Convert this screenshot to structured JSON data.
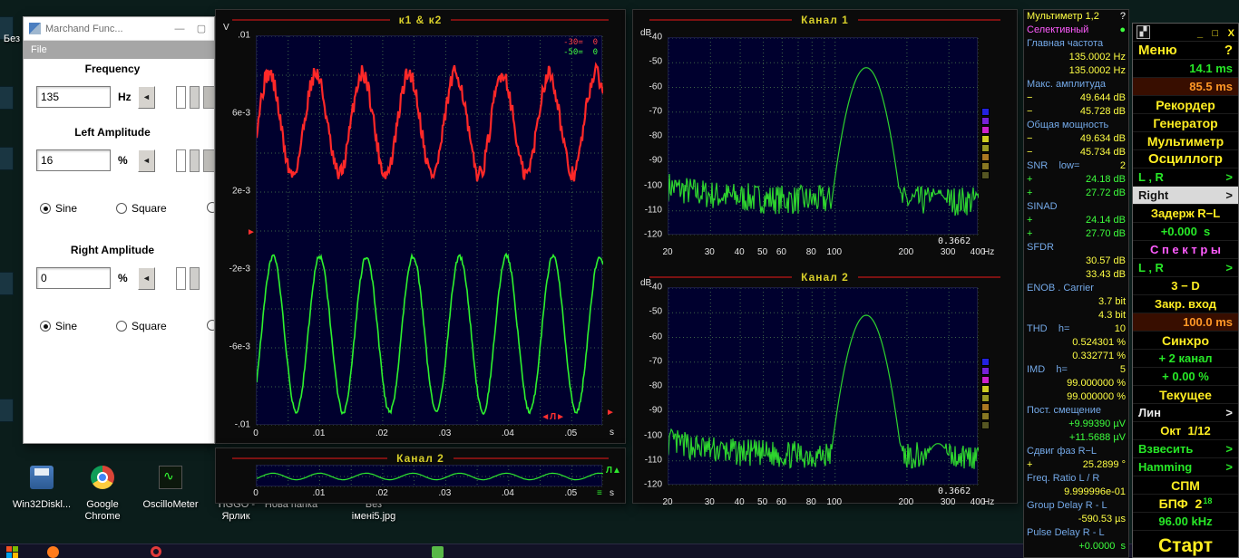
{
  "glyphs": {
    "arrow_right": "►",
    "spin_left": "◄",
    "pulse_trigger": "◄Л►",
    "pulse_up": "Л▲",
    "equals": "≡"
  },
  "desktop": {
    "edge_label": "Без",
    "edge_fragments": [
      18,
      95,
      162,
      300,
      440
    ],
    "icons": [
      {
        "name": "win32diskimager-icon",
        "x": 6,
        "w": 80,
        "icon": "disk",
        "lines": [
          "Win32Diskl..."
        ]
      },
      {
        "name": "google-chrome-icon",
        "x": 82,
        "w": 62,
        "icon": "chrome",
        "lines": [
          "Google",
          "Chrome"
        ]
      },
      {
        "name": "oscillometer-icon",
        "x": 148,
        "w": 80,
        "icon": "scope",
        "lines": [
          "OscilloMeter"
        ]
      },
      {
        "name": "tiggo-shortcut-icon",
        "x": 228,
        "w": 64,
        "icon": "",
        "lines": [
          "TIGGO -",
          "Ярлик"
        ]
      },
      {
        "name": "new-folder-icon",
        "x": 288,
        "w": 66,
        "icon": "",
        "lines": [
          "Нова папка"
        ]
      },
      {
        "name": "image-file-icon",
        "x": 376,
        "w": 72,
        "icon": "",
        "lines": [
          "Без",
          "імені5.jpg"
        ]
      }
    ]
  },
  "taskbar": {
    "icons": [
      {
        "type": "start",
        "name": "start-button",
        "x": 7,
        "colors": [
          "#f25022",
          "#7fba00",
          "#00a4ef",
          "#ffb900"
        ]
      },
      {
        "type": "dot",
        "name": "firefox-icon",
        "x": 52,
        "color": "#ff7b1c"
      },
      {
        "type": "ring",
        "name": "opera-icon",
        "x": 166,
        "color": "#e23a3a"
      },
      {
        "type": "dot2",
        "name": "folder-icon",
        "x": 476,
        "color": "#58b847"
      }
    ]
  },
  "generator": {
    "title": "Marchand Func...",
    "window_buttons": {
      "minimize": "—",
      "maximize": "▢"
    },
    "menu": {
      "file": "File"
    },
    "frequency": {
      "label": "Frequency",
      "value": "135",
      "unit": "Hz"
    },
    "left_amplitude": {
      "label": "Left Amplitude",
      "value": "16",
      "unit": "%"
    },
    "right_amplitude": {
      "label": "Right Amplitude",
      "value": "0",
      "unit": "%"
    },
    "waveforms": {
      "sine": "Sine",
      "square": "Square"
    }
  },
  "spectrum_swatches": [
    "#2222e0",
    "#7722d8",
    "#cc22cc",
    "#cccc22",
    "#999922",
    "#aa7722",
    "#887722",
    "#555522"
  ],
  "multimeter": {
    "rows": [
      {
        "l": "Мультиметр 1,2",
        "lc": "y",
        "r": "?",
        "rc": "w",
        "i": true
      },
      {
        "l": "Селективный",
        "lc": "m",
        "r": "●",
        "rc": "g",
        "i": true
      },
      {
        "l": "Главная частота",
        "lc": "c"
      },
      {
        "r": "135.0002 Hz",
        "rc": "y"
      },
      {
        "r": "135.0002 Hz",
        "rc": "y"
      },
      {
        "l": "Макс. амплитуда",
        "lc": "c"
      },
      {
        "l": "−",
        "lc": "y",
        "r": "49.644 dB",
        "rc": "y"
      },
      {
        "l": "−",
        "lc": "y",
        "r": "45.728 dB",
        "rc": "y"
      },
      {
        "l": "Общая мощность",
        "lc": "c"
      },
      {
        "l": "−",
        "lc": "y",
        "r": "49.634 dB",
        "rc": "y"
      },
      {
        "l": "−",
        "lc": "y",
        "r": "45.734 dB",
        "rc": "y"
      },
      {
        "l": "SNR    low=",
        "lc": "c",
        "r": "2",
        "rc": "y"
      },
      {
        "l": "+",
        "lc": "g",
        "r": "24.18 dB",
        "rc": "g"
      },
      {
        "l": "+",
        "lc": "g",
        "r": "27.72 dB",
        "rc": "g"
      },
      {
        "l": "SINAD",
        "lc": "c"
      },
      {
        "l": "+",
        "lc": "g",
        "r": "24.14 dB",
        "rc": "g"
      },
      {
        "l": "+",
        "lc": "g",
        "r": "27.70 dB",
        "rc": "g"
      },
      {
        "l": "SFDR",
        "lc": "c"
      },
      {
        "r": "30.57 dB",
        "rc": "y"
      },
      {
        "r": "33.43 dB",
        "rc": "y"
      },
      {
        "l": "ENOB . Carrier",
        "lc": "c"
      },
      {
        "r": "3.7 bit",
        "rc": "y"
      },
      {
        "r": "4.3 bit",
        "rc": "y"
      },
      {
        "l": "THD    h=",
        "lc": "c",
        "r": "10",
        "rc": "y"
      },
      {
        "r": "0.524301 %",
        "rc": "y"
      },
      {
        "r": "0.332771 %",
        "rc": "y"
      },
      {
        "l": "IMD    h=",
        "lc": "c",
        "r": "5",
        "rc": "y"
      },
      {
        "r": "99.000000 %",
        "rc": "y"
      },
      {
        "r": "99.000000 %",
        "rc": "y"
      },
      {
        "l": "Пост. смещение",
        "lc": "c"
      },
      {
        "r": "+9.99390 µV",
        "rc": "g"
      },
      {
        "r": "+11.5688 µV",
        "rc": "g"
      },
      {
        "l": "Сдвиг фаз R−L",
        "lc": "c"
      },
      {
        "l": "+",
        "lc": "y",
        "r": "25.2899 °",
        "rc": "y"
      },
      {
        "l": "Freq. Ratio L / R",
        "lc": "c"
      },
      {
        "r": "9.999996e-01",
        "rc": "y"
      },
      {
        "l": "Group Delay R - L",
        "lc": "c"
      },
      {
        "r": "-590.53 µs",
        "rc": "y"
      },
      {
        "l": "Pulse Delay R - L",
        "lc": "c"
      },
      {
        "r": "+0.0000  s",
        "rc": "g"
      }
    ]
  },
  "control": {
    "app_icon_glyph": "▞",
    "window": {
      "minimize": "_",
      "maximize": "□",
      "close": "X"
    },
    "rows": [
      {
        "n": "menu",
        "t": "Меню",
        "c": "y",
        "size": 15,
        "right": "?",
        "rc": "y",
        "align": "left"
      },
      {
        "n": "time-window",
        "t": "14.1 ms",
        "c": "g",
        "align": "right"
      },
      {
        "n": "latency",
        "t": "85.5 ms",
        "c": "o",
        "align": "right",
        "bg": "#380e00"
      },
      {
        "n": "recorder",
        "t": "Рекордер",
        "c": "y",
        "size": 14
      },
      {
        "n": "generator",
        "t": "Генератор",
        "c": "y",
        "size": 14
      },
      {
        "n": "multimeter",
        "t": "Мультиметр",
        "c": "y",
        "size": 14
      },
      {
        "n": "oscilloscope",
        "t": "Осциллогр",
        "c": "y",
        "size": 15
      },
      {
        "n": "channels-lr",
        "t": "L , R",
        "c": "g",
        "right": ">",
        "rc": "g",
        "align": "left"
      },
      {
        "n": "channel-right",
        "t": "Right",
        "c": "k",
        "right": ">",
        "rc": "k",
        "align": "left",
        "bg": "#d9d9d9"
      },
      {
        "n": "delay-rl",
        "t": "Задерж R−L",
        "c": "y"
      },
      {
        "n": "delay-value",
        "t": "+0.000  s",
        "c": "g"
      },
      {
        "n": "spectra",
        "t": "С п е к т р ы",
        "c": "m"
      },
      {
        "n": "spectra-lr",
        "t": "L , R",
        "c": "g",
        "right": ">",
        "rc": "g",
        "align": "left"
      },
      {
        "n": "three-d",
        "t": "3 − D",
        "c": "y"
      },
      {
        "n": "closed-input",
        "t": "Закр. вход",
        "c": "y"
      },
      {
        "n": "buffer",
        "t": "100.0 ms",
        "c": "o",
        "align": "right",
        "bg": "#380e00"
      },
      {
        "n": "sync",
        "t": "Синхро",
        "c": "y",
        "size": 14
      },
      {
        "n": "plus-2-channel",
        "t": "+ 2 канал",
        "c": "g"
      },
      {
        "n": "sync-percent",
        "t": "+ 0.00 %",
        "c": "g"
      },
      {
        "n": "current",
        "t": "Текущее",
        "c": "y",
        "size": 14
      },
      {
        "n": "lin",
        "t": "Лин",
        "c": "w",
        "right": ">",
        "rc": "w",
        "align": "left"
      },
      {
        "n": "oct",
        "t": "Окт  1/12",
        "c": "y"
      },
      {
        "n": "weighting",
        "t": "Взвесить",
        "c": "g",
        "right": ">",
        "rc": "g",
        "align": "left"
      },
      {
        "n": "window-hamming",
        "t": "Hamming",
        "c": "g",
        "right": ">",
        "rc": "g",
        "align": "left"
      },
      {
        "n": "spm",
        "t": "СПМ",
        "c": "y",
        "size": 14
      },
      {
        "n": "fft",
        "t": "БПФ  2",
        "c": "y",
        "size": 14,
        "sup": "18",
        "supc": "g"
      },
      {
        "n": "samplerate",
        "t": "96.00 kHz",
        "c": "g"
      },
      {
        "n": "start",
        "t": "Старт",
        "c": "y",
        "size": 21,
        "h": 34
      }
    ]
  },
  "chart_data": [
    {
      "id": "scope-main",
      "type": "line",
      "title": "к1 & к2",
      "xlabel": "s",
      "ylabel": "V",
      "xlim": [
        0,
        0.055
      ],
      "ylim": [
        -0.01,
        0.01
      ],
      "grid": {
        "dx": 0.005,
        "dy": 0.002
      },
      "x_ticks": [
        {
          "v": 0,
          "t": "0"
        },
        {
          "v": 0.01,
          "t": ".01"
        },
        {
          "v": 0.02,
          "t": ".02"
        },
        {
          "v": 0.03,
          "t": ".03"
        },
        {
          "v": 0.04,
          "t": ".04"
        },
        {
          "v": 0.05,
          "t": ".05"
        }
      ],
      "y_ticks": [
        {
          "v": 0.01,
          "t": ".01"
        },
        {
          "v": 0.006,
          "t": "6e-3"
        },
        {
          "v": 0.002,
          "t": "2e-3"
        },
        {
          "v": -0.002,
          "t": "-2e-3"
        },
        {
          "v": -0.006,
          "t": "-6e-3"
        },
        {
          "v": -0.01,
          "t": "-.01"
        }
      ],
      "overlay": [
        {
          "t": "-30=  0",
          "color": "#ff4040"
        },
        {
          "t": "-50=  0",
          "color": "#40ff40"
        }
      ],
      "series": [
        {
          "name": "channel-1-left",
          "color": "#ff2828",
          "waveform": "sine",
          "freq_hz": 135,
          "amplitude_v": 0.0026,
          "offset_v": 0.0055,
          "phase": -0.1,
          "noise_v": 0.00045,
          "width": 2.2
        },
        {
          "name": "channel-2-right",
          "color": "#2ef22e",
          "waveform": "sine",
          "freq_hz": 135,
          "amplitude_v": 0.004,
          "offset_v": -0.0053,
          "phase": -0.63,
          "noise_v": 0.00012,
          "width": 1.6
        }
      ]
    },
    {
      "id": "scope-small",
      "type": "line",
      "title": "Канал 2",
      "xlabel": "s",
      "ylabel": "",
      "xlim": [
        0,
        0.055
      ],
      "ylim": [
        -0.01,
        0.01
      ],
      "grid": {
        "dx": 0.005,
        "dy": 0.01
      },
      "x_ticks": [
        {
          "v": 0,
          "t": "0"
        },
        {
          "v": 0.01,
          "t": ".01"
        },
        {
          "v": 0.02,
          "t": ".02"
        },
        {
          "v": 0.03,
          "t": ".03"
        },
        {
          "v": 0.04,
          "t": ".04"
        },
        {
          "v": 0.05,
          "t": ".05"
        }
      ],
      "series": [
        {
          "name": "channel-2-preview",
          "color": "#2ee82e",
          "waveform": "sine",
          "freq_hz": 135,
          "amplitude_v": 0.003,
          "offset_v": 0,
          "phase": -0.63,
          "noise_v": 0.0001,
          "width": 1.2
        }
      ]
    },
    {
      "id": "spectrum-ch1",
      "type": "line",
      "title": "Канал 1",
      "xlabel": "Hz",
      "ylabel": "dB",
      "x_scale": "log",
      "xlim": [
        20,
        400
      ],
      "ylim": [
        -120,
        -40
      ],
      "grid_x": [
        20,
        30,
        40,
        50,
        60,
        70,
        80,
        90,
        100,
        200,
        300,
        400
      ],
      "x_ticks": [
        {
          "v": 20,
          "t": "20"
        },
        {
          "v": 30,
          "t": "30"
        },
        {
          "v": 40,
          "t": "40"
        },
        {
          "v": 50,
          "t": "50"
        },
        {
          "v": 60,
          "t": "60"
        },
        {
          "v": 80,
          "t": "80"
        },
        {
          "v": 100,
          "t": "100"
        },
        {
          "v": 200,
          "t": "200"
        },
        {
          "v": 300,
          "t": "300"
        },
        {
          "v": 400,
          "t": "400"
        }
      ],
      "y_ticks": [
        {
          "v": -40,
          "t": "-40"
        },
        {
          "v": -50,
          "t": "-50"
        },
        {
          "v": -60,
          "t": "-60"
        },
        {
          "v": -70,
          "t": "-70"
        },
        {
          "v": -80,
          "t": "-80"
        },
        {
          "v": -90,
          "t": "-90"
        },
        {
          "v": -100,
          "t": "-100"
        },
        {
          "v": -110,
          "t": "-110"
        },
        {
          "v": -120,
          "t": "-120"
        }
      ],
      "trace": {
        "color": "#2ed32e",
        "noise_floor_db": -106,
        "noise_spread_db": 12,
        "peak_freq_hz": 135,
        "peak_db": -52,
        "seed": 7
      },
      "readout": "0.3662"
    },
    {
      "id": "spectrum-ch2",
      "type": "line",
      "title": "Канал 2",
      "xlabel": "Hz",
      "ylabel": "dB",
      "x_scale": "log",
      "xlim": [
        20,
        400
      ],
      "ylim": [
        -120,
        -40
      ],
      "grid_x": [
        20,
        30,
        40,
        50,
        60,
        70,
        80,
        90,
        100,
        200,
        300,
        400
      ],
      "x_ticks": [
        {
          "v": 20,
          "t": "20"
        },
        {
          "v": 30,
          "t": "30"
        },
        {
          "v": 40,
          "t": "40"
        },
        {
          "v": 50,
          "t": "50"
        },
        {
          "v": 60,
          "t": "60"
        },
        {
          "v": 80,
          "t": "80"
        },
        {
          "v": 100,
          "t": "100"
        },
        {
          "v": 200,
          "t": "200"
        },
        {
          "v": 300,
          "t": "300"
        },
        {
          "v": 400,
          "t": "400"
        }
      ],
      "y_ticks": [
        {
          "v": -40,
          "t": "-40"
        },
        {
          "v": -50,
          "t": "-50"
        },
        {
          "v": -60,
          "t": "-60"
        },
        {
          "v": -70,
          "t": "-70"
        },
        {
          "v": -80,
          "t": "-80"
        },
        {
          "v": -90,
          "t": "-90"
        },
        {
          "v": -100,
          "t": "-100"
        },
        {
          "v": -110,
          "t": "-110"
        },
        {
          "v": -120,
          "t": "-120"
        }
      ],
      "trace": {
        "color": "#2ed32e",
        "noise_floor_db": -108,
        "noise_spread_db": 11,
        "peak_freq_hz": 135,
        "peak_db": -51,
        "seed": 13
      },
      "readout": "0.3662"
    }
  ]
}
